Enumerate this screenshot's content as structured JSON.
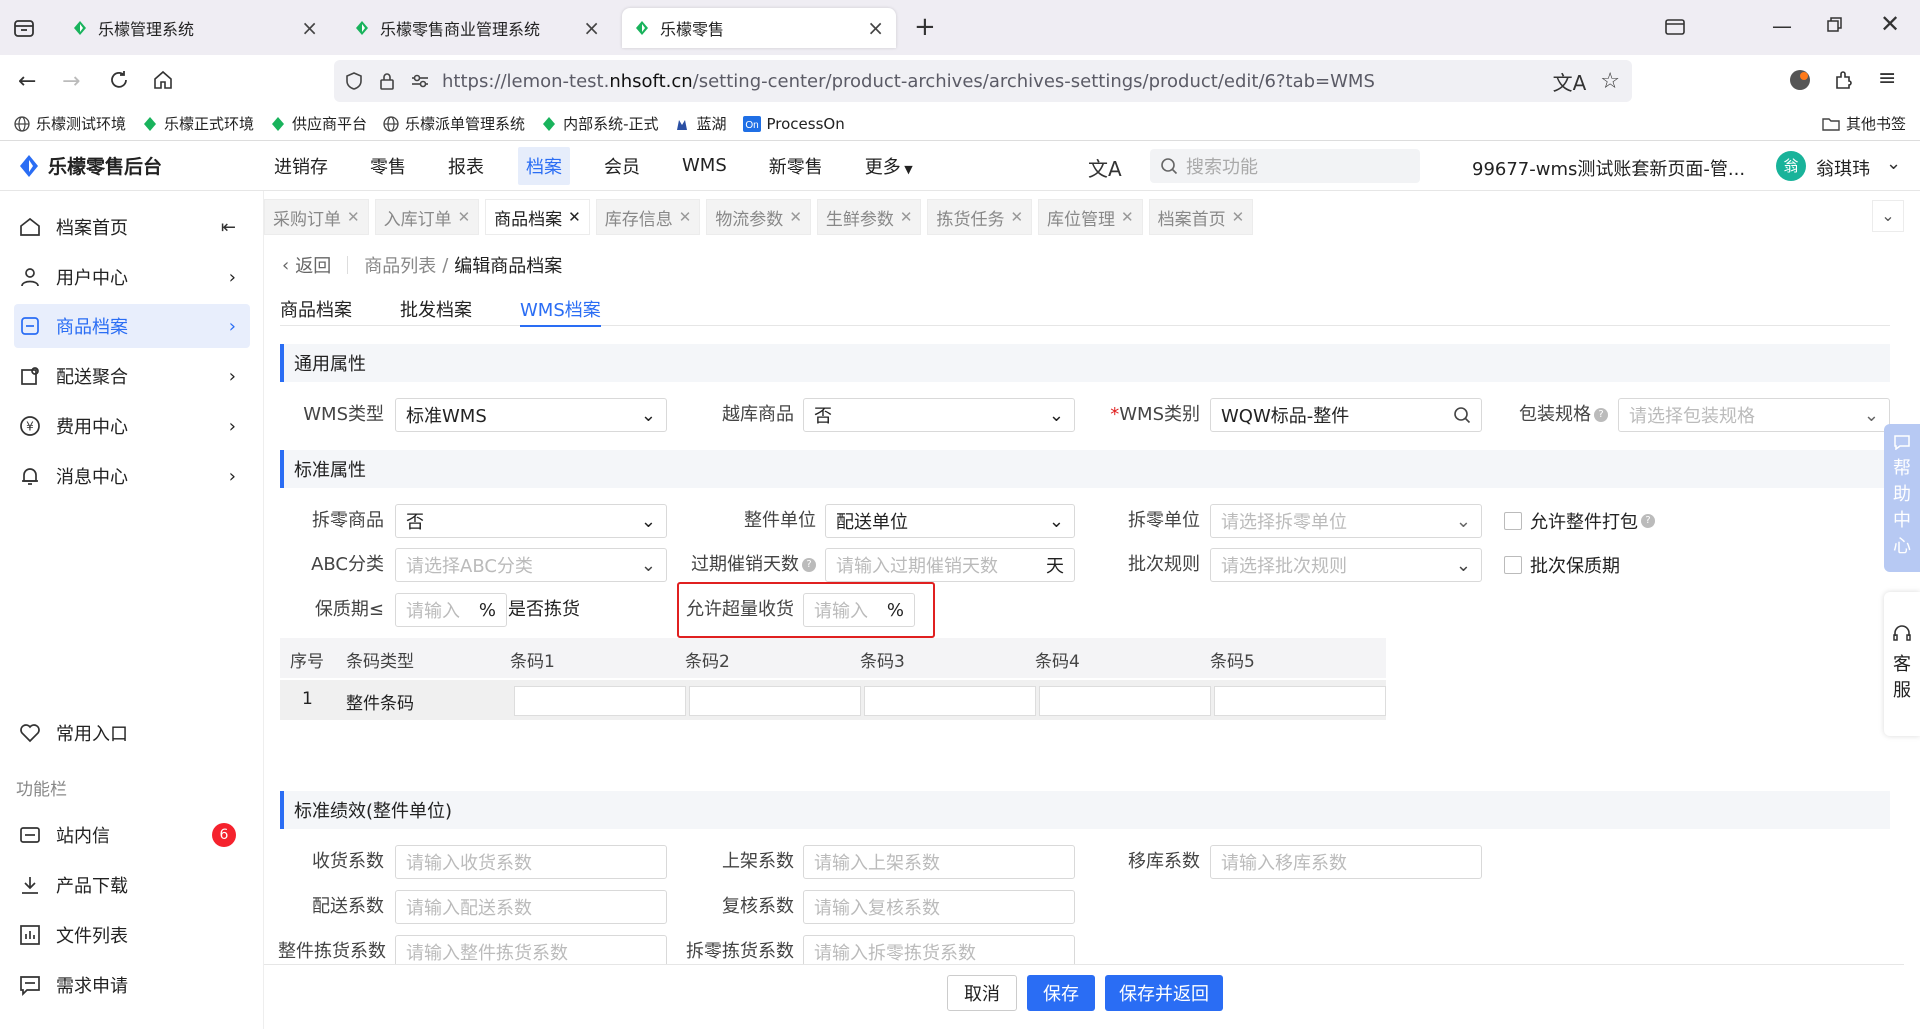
{
  "browser": {
    "tabs": [
      {
        "title": "乐檬管理系统"
      },
      {
        "title": "乐檬零售商业管理系统"
      },
      {
        "title": "乐檬零售"
      }
    ],
    "url_prefix": "https://lemon-test.",
    "url_domain": "nhsoft.cn",
    "url_path": "/setting-center/product-archives/archives-settings/product/edit/6?tab=WMS",
    "bookmarks": [
      "乐檬测试环境",
      "乐檬正式环境",
      "供应商平台",
      "乐檬派单管理系统",
      "内部系统-正式",
      "蓝湖",
      "ProcessOn"
    ],
    "other_bookmarks": "其他书签"
  },
  "app": {
    "logo": "乐檬零售后台",
    "nav": [
      "进销存",
      "零售",
      "报表",
      "档案",
      "会员",
      "WMS",
      "新零售",
      "更多"
    ],
    "active_nav": "档案",
    "search_placeholder": "搜索功能",
    "account": "99677-wms测试账套新页面-管...",
    "avatar_char": "翁",
    "user": "翁琪玮"
  },
  "sidebar": {
    "items": [
      "档案首页",
      "用户中心",
      "商品档案",
      "配送聚合",
      "费用中心",
      "消息中心"
    ],
    "common_entry": "常用入口",
    "func_bar": "功能栏",
    "bottom": [
      "站内信",
      "产品下载",
      "文件列表",
      "需求申请"
    ],
    "badge": "6"
  },
  "content_tabs": [
    "采购订单",
    "入库订单",
    "商品档案",
    "库存信息",
    "物流参数",
    "生鲜参数",
    "拣货任务",
    "库位管理",
    "档案首页"
  ],
  "breadcrumb": {
    "back": "返回",
    "list": "商品列表",
    "sep": "/",
    "current": "编辑商品档案"
  },
  "subtabs": [
    "商品档案",
    "批发档案",
    "WMS档案"
  ],
  "sections": {
    "general": "通用属性",
    "standard": "标准属性",
    "perf": "标准绩效(整件单位)"
  },
  "general": {
    "wms_type_label": "WMS类型",
    "wms_type": "标准WMS",
    "cross_label": "越库商品",
    "cross": "否",
    "required_mark": "*",
    "wms_cat_label": "WMS类别",
    "wms_cat": "WQW标品-整件",
    "pack_label": "包装规格",
    "pack_ph": "请选择包装规格"
  },
  "standard": {
    "split_label": "拆零商品",
    "split": "否",
    "whole_unit_label": "整件单位",
    "whole_unit": "配送单位",
    "split_unit_label": "拆零单位",
    "split_unit_ph": "请选择拆零单位",
    "allow_pack": "允许整件打包",
    "abc_label": "ABC分类",
    "abc_ph": "请选择ABC分类",
    "expire_label": "过期催销天数",
    "expire_ph": "请输入过期催销天数",
    "expire_unit": "天",
    "batch_label": "批次规则",
    "batch_ph": "请选择批次规则",
    "batch_shelf": "批次保质期",
    "shelf_label": "保质期≤",
    "shelf_ph": "请输入",
    "percent": "%",
    "pick_label": "是否拣货",
    "over_label": "允许超量收货",
    "over_ph": "请输入"
  },
  "barcode": {
    "headers": [
      "序号",
      "条码类型",
      "条码1",
      "条码2",
      "条码3",
      "条码4",
      "条码5"
    ],
    "row": {
      "index": "1",
      "type": "整件条码"
    }
  },
  "perf": {
    "recv_label": "收货系数",
    "recv_ph": "请输入收货系数",
    "shelf_label": "上架系数",
    "shelf_ph": "请输入上架系数",
    "move_label": "移库系数",
    "move_ph": "请输入移库系数",
    "dist_label": "配送系数",
    "dist_ph": "请输入配送系数",
    "recheck_label": "复核系数",
    "recheck_ph": "请输入复核系数",
    "whole_pick_label": "整件拣货系数",
    "whole_pick_ph": "请输入整件拣货系数",
    "split_pick_label": "拆零拣货系数",
    "split_pick_ph": "请输入拆零拣货系数"
  },
  "footer": {
    "cancel": "取消",
    "save": "保存",
    "save_back": "保存并返回"
  },
  "float": {
    "help": [
      "帮",
      "助",
      "中",
      "心"
    ],
    "service": [
      "客",
      "服"
    ]
  },
  "colors": {
    "accent": "#2a6df4",
    "highlight": "#e02020",
    "badge": "#f5222d",
    "brand_green": "#19b35c"
  }
}
